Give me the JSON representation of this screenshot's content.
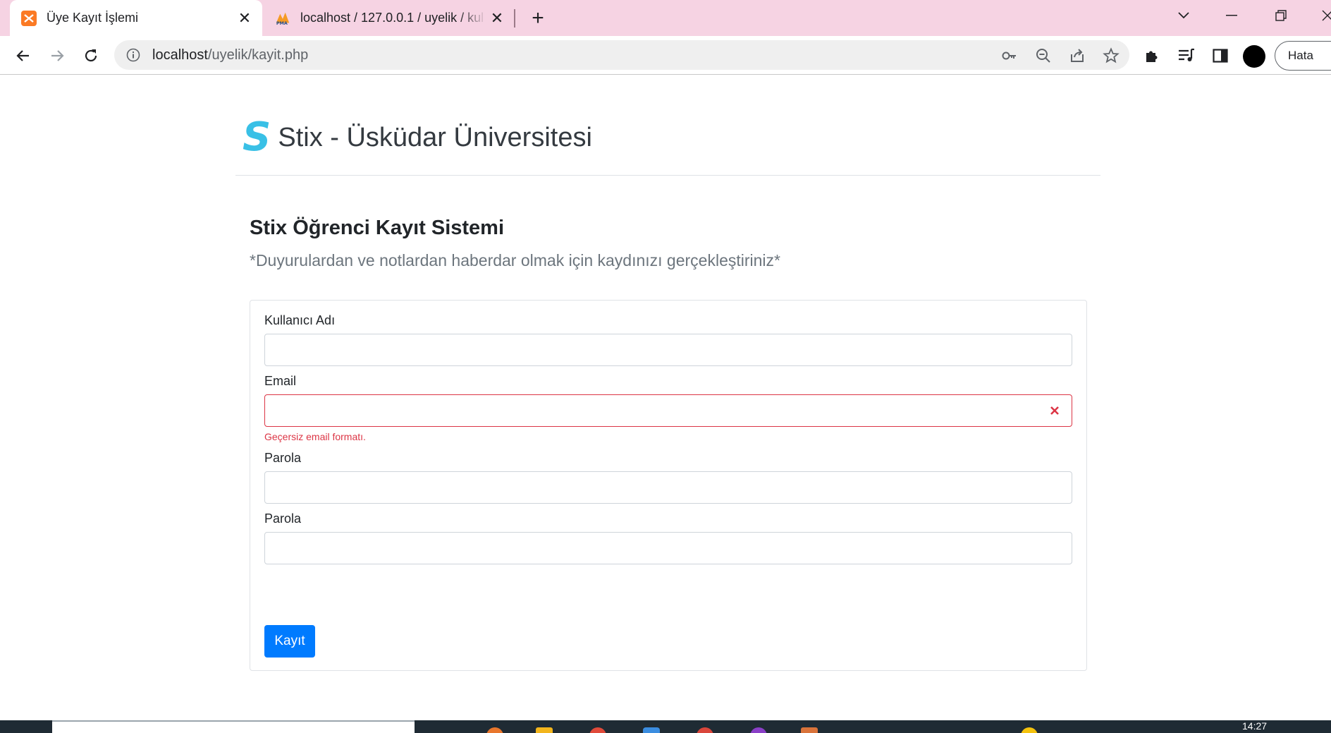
{
  "browser": {
    "tabs": [
      {
        "title": "Üye Kayıt İşlemi",
        "active": true,
        "favicon": "xampp-icon"
      },
      {
        "title": "localhost / 127.0.0.1 / uyelik / kul",
        "active": false,
        "favicon": "phpmyadmin-icon"
      }
    ],
    "url_host": "localhost",
    "url_path": "/uyelik/kayit.php",
    "profile_button_label": "Hata"
  },
  "page": {
    "brand_logo": "S",
    "brand_title": "Stix - Üsküdar Üniversitesi",
    "heading": "Stix Öğrenci Kayıt Sistemi",
    "lead": "*Duyurulardan ve notlardan haberdar olmak için kaydınızı gerçekleştiriniz*",
    "form": {
      "username_label": "Kullanıcı Adı",
      "username_value": "",
      "email_label": "Email",
      "email_value": "",
      "email_error": "Geçersiz email formatı.",
      "password_label": "Parola",
      "password_value": "",
      "password_confirm_label": "Parola",
      "password_confirm_value": "",
      "submit_label": "Kayıt"
    }
  },
  "taskbar": {
    "time": "14:27"
  },
  "colors": {
    "tabbar_bg": "#f6d3e3",
    "brand_accent": "#39c0e6",
    "primary_button": "#007bff",
    "error": "#dc3545"
  }
}
